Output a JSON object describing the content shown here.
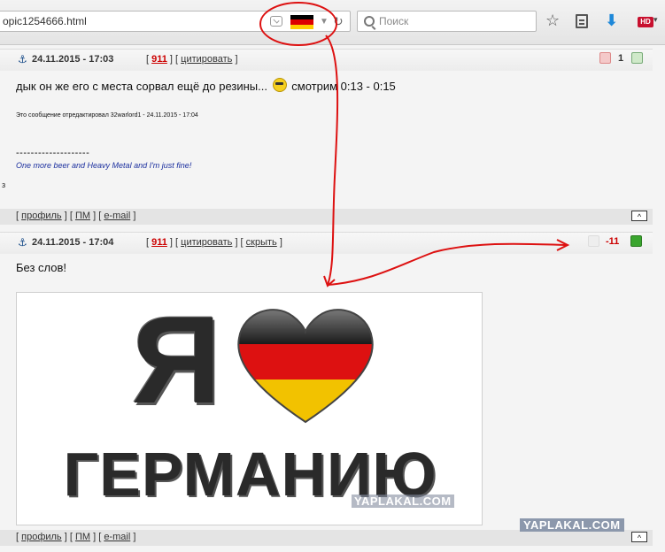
{
  "browser": {
    "url": "opic1254666.html",
    "search_placeholder": "Поиск",
    "hd_badge": "HD",
    "icons": [
      "pocket-icon",
      "germany-flag-icon",
      "dropdown-icon",
      "reload-icon",
      "search-icon",
      "bookmark-star-icon",
      "reading-list-icon",
      "download-icon",
      "hd-extension-icon",
      "menu-icon"
    ]
  },
  "colors": {
    "accent_red": "#cc0000",
    "annotation_red": "#dd1111",
    "flag_black": "#000000",
    "flag_red": "#dd0000",
    "flag_gold": "#ffce00",
    "signature_blue": "#1a2e9e",
    "vote_green": "#3aa52e"
  },
  "posts": [
    {
      "date": "24.11.2015 - 17:03",
      "number": "911",
      "quote": "цитировать",
      "rating": "1",
      "text_before": "дык он же его с места сорвал ещё до резины...",
      "text_after": "смотрим 0:13 - 0:15",
      "edit_note": "Это сообщение отредактировал 32warlord1 - 24.11.2015 - 17:04",
      "sig_separator": "--------------------",
      "signature": "One more beer and Heavy Metal and I'm just fine!",
      "stray": "з",
      "footer": {
        "profile": "профиль",
        "pm": "ПМ",
        "email": "e-mail",
        "top": "^"
      }
    },
    {
      "date": "24.11.2015 - 17:04",
      "number": "911",
      "quote": "цитировать",
      "hide": "скрыть",
      "rating": "-11",
      "text": "Без слов!",
      "image": {
        "line1": "Я",
        "line2": "ГЕРМАНИЮ",
        "watermark": "YAPLAKAL.COM"
      },
      "footer": {
        "profile": "профиль",
        "pm": "ПМ",
        "email": "e-mail",
        "top": "^"
      }
    }
  ],
  "watermark": "YAPLAKAL.COM"
}
